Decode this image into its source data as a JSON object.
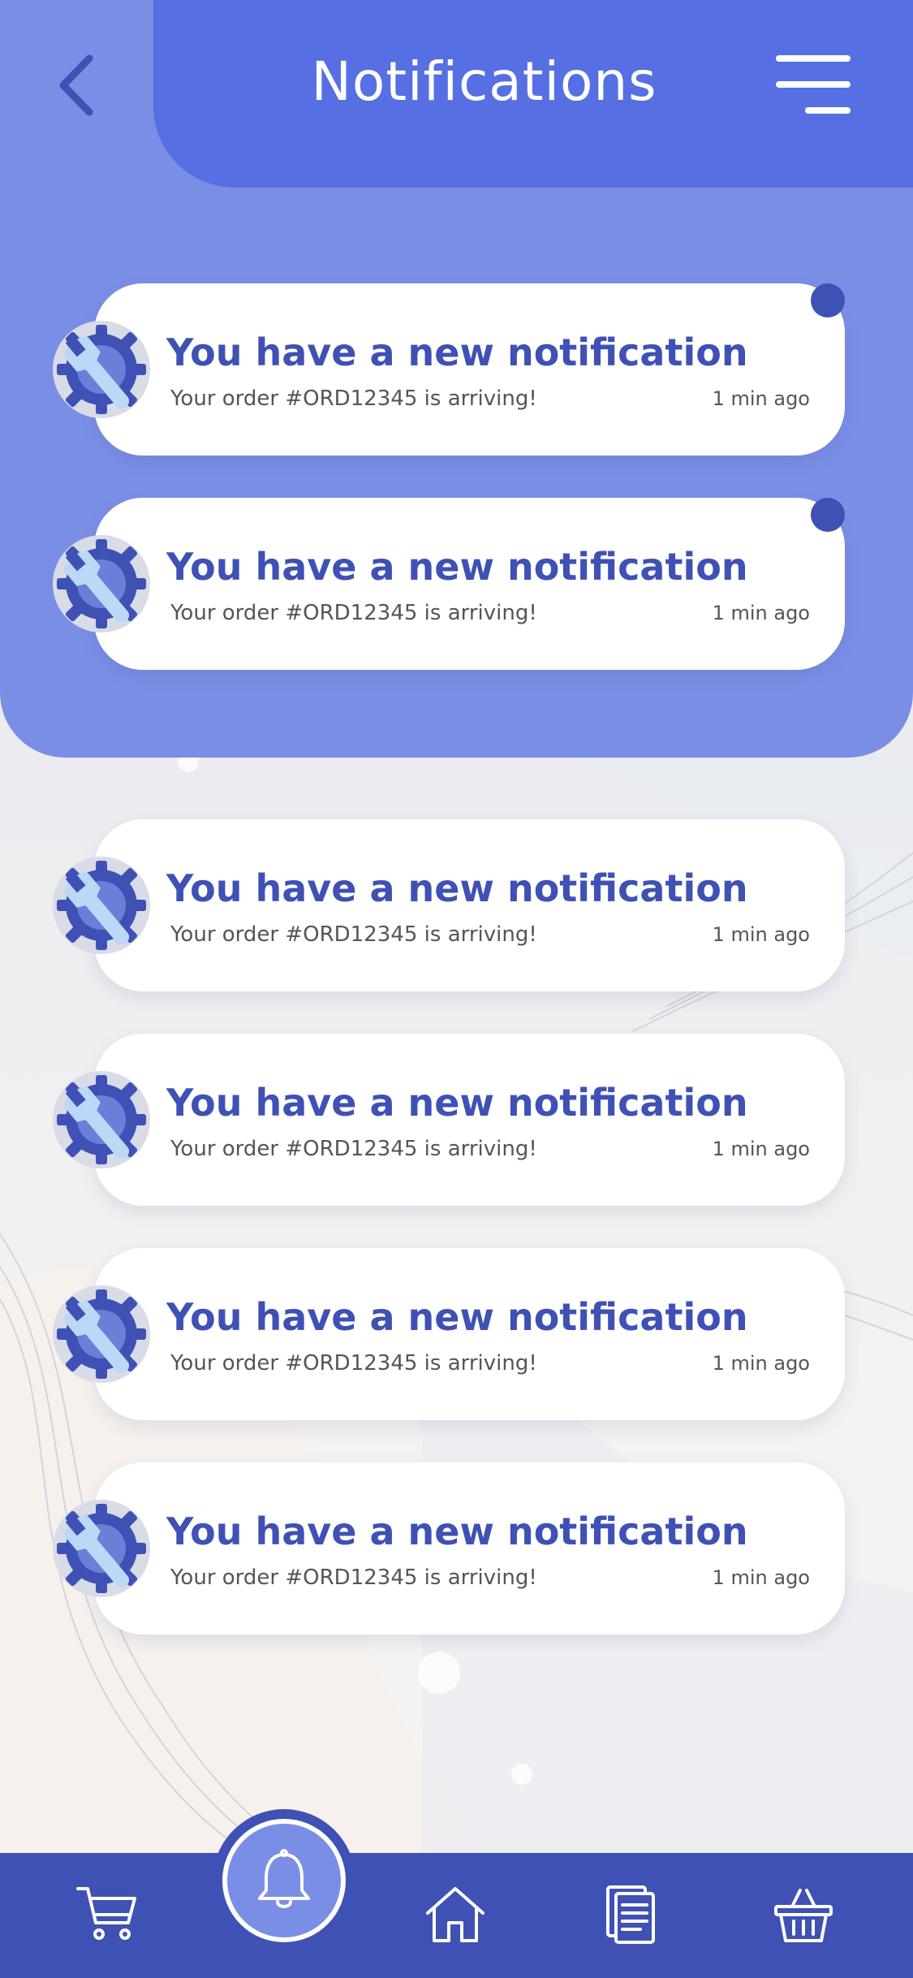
{
  "header": {
    "title": "Notifications",
    "back_icon": "chevron-left-icon",
    "menu_icon": "hamburger-menu-icon"
  },
  "notifications": [
    {
      "title": "You have a new notification",
      "message": "Your order #ORD12345 is arriving!",
      "time": "1 min ago",
      "unread": true,
      "icon": "settings-wrench-icon"
    },
    {
      "title": "You have a new notification",
      "message": "Your order #ORD12345 is arriving!",
      "time": "1 min ago",
      "unread": true,
      "icon": "settings-wrench-icon"
    },
    {
      "title": "You have a new notification",
      "message": "Your order #ORD12345 is arriving!",
      "time": "1 min ago",
      "unread": false,
      "icon": "settings-wrench-icon"
    },
    {
      "title": "You have a new notification",
      "message": "Your order #ORD12345 is arriving!",
      "time": "1 min ago",
      "unread": false,
      "icon": "settings-wrench-icon"
    },
    {
      "title": "You have a new notification",
      "message": "Your order #ORD12345 is arriving!",
      "time": "1 min ago",
      "unread": false,
      "icon": "settings-wrench-icon"
    },
    {
      "title": "You have a new notification",
      "message": "Your order #ORD12345 is arriving!",
      "time": "1 min ago",
      "unread": false,
      "icon": "settings-wrench-icon"
    }
  ],
  "bottom_nav": {
    "items": [
      {
        "icon": "cart-icon"
      },
      {
        "icon": "bell-icon",
        "active": true
      },
      {
        "icon": "home-icon"
      },
      {
        "icon": "document-icon"
      },
      {
        "icon": "basket-icon"
      }
    ]
  },
  "colors": {
    "primary": "#3f51b5",
    "header": "#566fe3",
    "panel": "#7b8ee6",
    "card": "#ffffff"
  }
}
